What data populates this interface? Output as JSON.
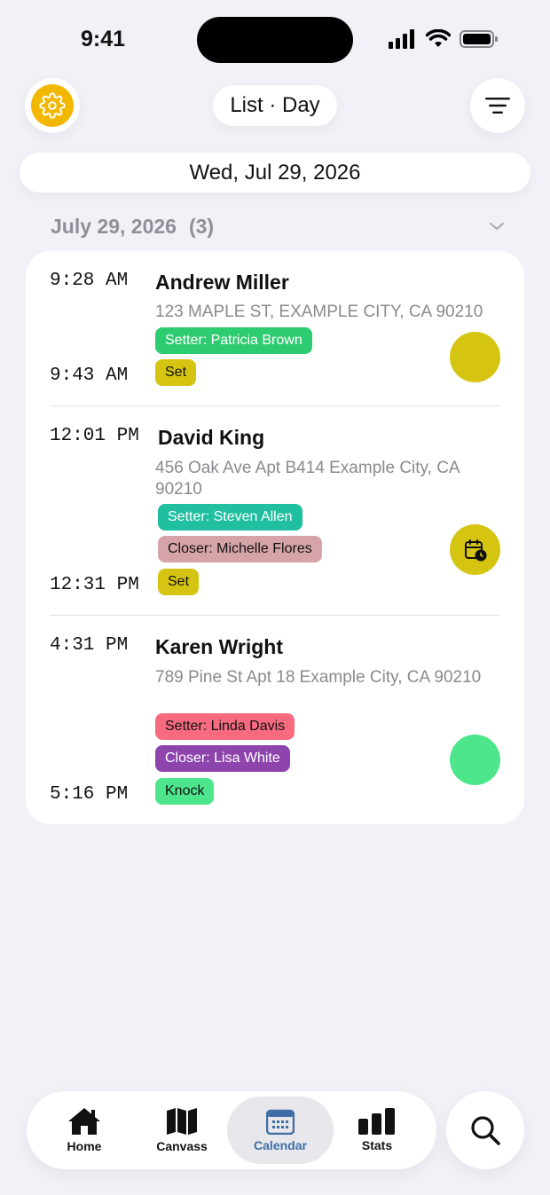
{
  "status_bar": {
    "time": "9:41"
  },
  "header": {
    "view_label": "List · Day",
    "date": "Wed, Jul 29, 2026"
  },
  "section": {
    "title": "July 29, 2026",
    "count": "(3)"
  },
  "appointments": [
    {
      "start": "9:28 AM",
      "end": "9:43 AM",
      "name": "Andrew Miller",
      "address": "123 MAPLE ST, EXAMPLE CITY, CA 90210",
      "setter": "Setter: Patricia Brown",
      "status": "Set",
      "circle_color": "#d6c412"
    },
    {
      "start": "12:01 PM",
      "end": "12:31 PM",
      "name": "David King",
      "address": "456 Oak Ave Apt B414 Example City, CA 90210",
      "setter": "Setter: Steven Allen",
      "closer": "Closer: Michelle Flores",
      "status": "Set",
      "circle_color": "#d6c412",
      "circle_icon": "calendar-clock-icon"
    },
    {
      "start": "4:31 PM",
      "end": "5:16 PM",
      "name": "Karen Wright",
      "address": "789 Pine St Apt 18 Example City, CA 90210",
      "setter": "Setter: Linda Davis",
      "closer": "Closer: Lisa White",
      "status": "Knock",
      "circle_color": "#4de68d"
    }
  ],
  "tabbar": {
    "home": "Home",
    "canvass": "Canvass",
    "calendar": "Calendar",
    "stats": "Stats"
  },
  "colors": {
    "accent_yellow": "#f2b800",
    "active_tab": "#3f6ea7",
    "tag_setter_green": "#2ecc71",
    "tag_setter_teal": "#1fbf9f",
    "tag_closer_rose": "#d5a3a8",
    "tag_set_yellow": "#d6c412",
    "tag_setter_red": "#f76a7f",
    "tag_closer_purple": "#8e44ad",
    "tag_knock_green": "#4de68d"
  }
}
